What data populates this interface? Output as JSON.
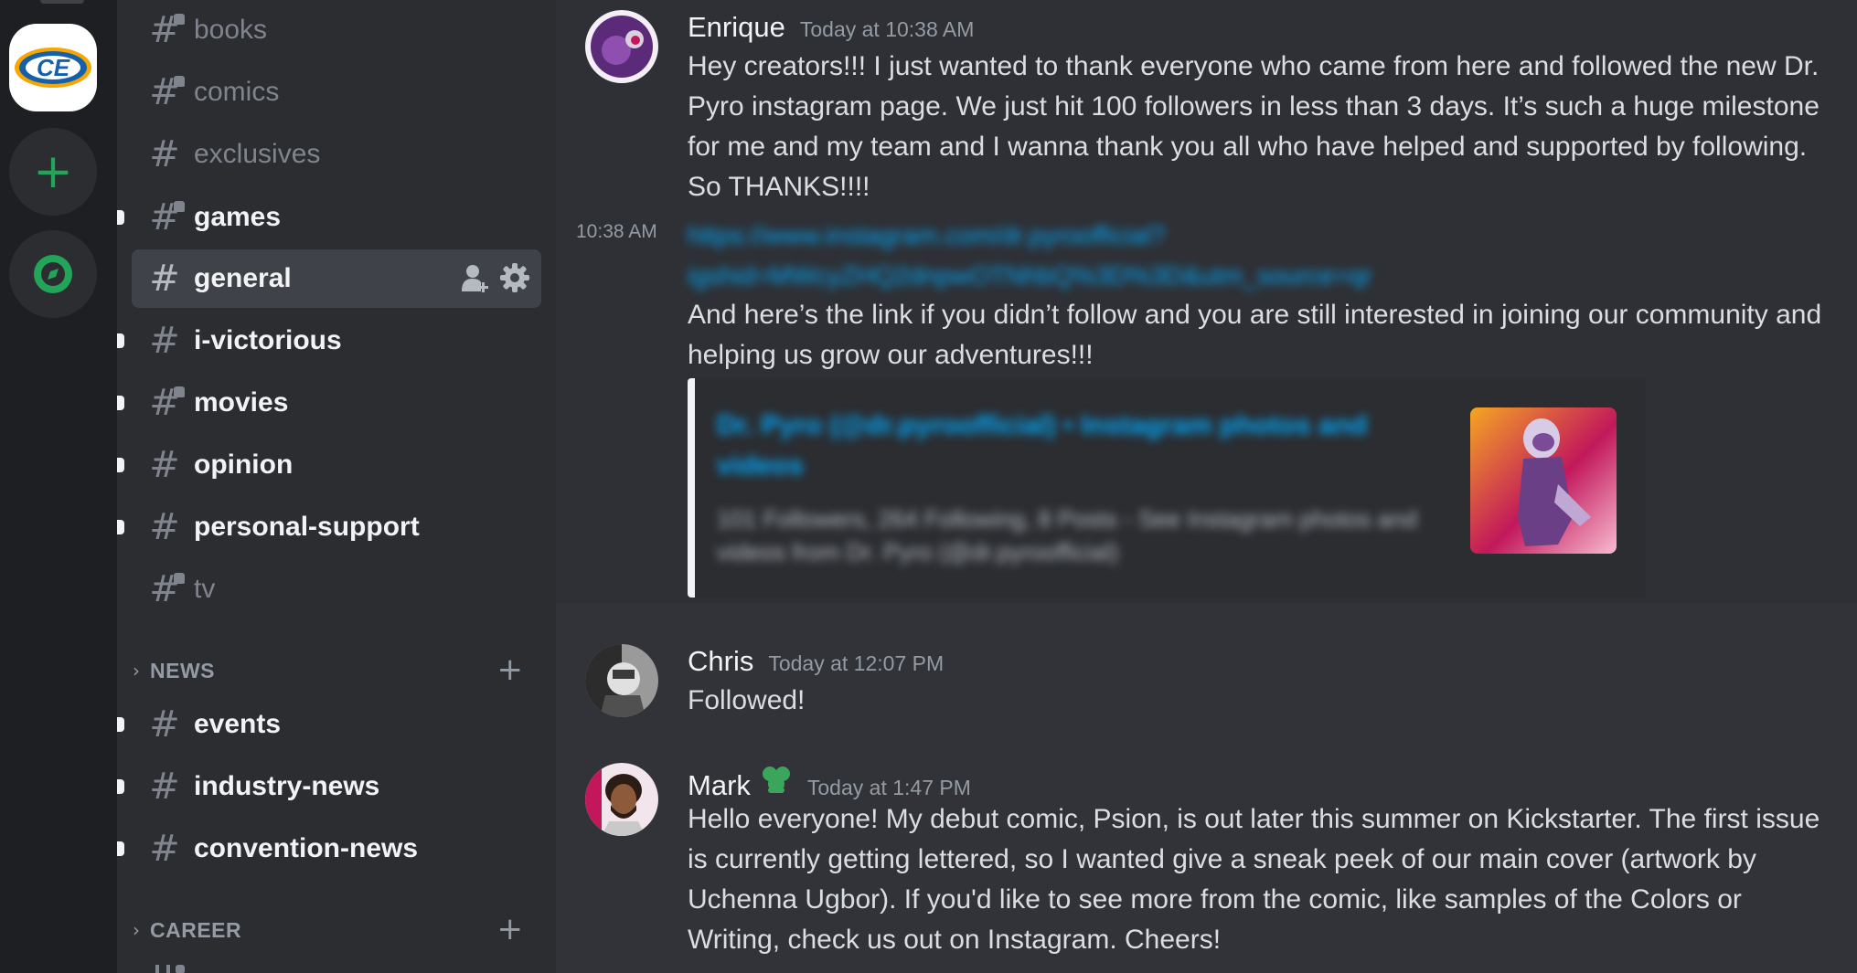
{
  "servers": [
    {
      "name": "ce-server",
      "logo_text": "CE"
    },
    {
      "name": "add-server"
    },
    {
      "name": "explore-servers"
    }
  ],
  "channels_top": [
    {
      "name": "books",
      "unread": false,
      "restricted": true
    },
    {
      "name": "comics",
      "unread": false,
      "restricted": true
    },
    {
      "name": "exclusives",
      "unread": false,
      "restricted": false
    },
    {
      "name": "games",
      "unread": true,
      "restricted": true
    },
    {
      "name": "general",
      "active": true
    },
    {
      "name": "i-victorious",
      "unread": true
    },
    {
      "name": "movies",
      "unread": true,
      "restricted": true
    },
    {
      "name": "opinion",
      "unread": true
    },
    {
      "name": "personal-support",
      "unread": true
    },
    {
      "name": "tv",
      "unread": false,
      "restricted": true
    }
  ],
  "categories": [
    {
      "label": "NEWS"
    },
    {
      "label": "CAREER"
    }
  ],
  "channels_news": [
    {
      "name": "events",
      "unread": true
    },
    {
      "name": "industry-news",
      "unread": true
    },
    {
      "name": "convention-news",
      "unread": true
    }
  ],
  "icons": {
    "add_server": "+",
    "hash": "#",
    "category_chevron": "›",
    "category_add": "+"
  },
  "colors": {
    "accent_green": "#23a559",
    "link_blue": "#00a8fc",
    "badge_green": "#3ba55c"
  },
  "messages": {
    "m1": {
      "author": "Enrique",
      "timestamp": "Today at 10:38 AM",
      "text": "Hey creators!!! I just wanted to thank everyone who came from here and followed the new Dr. Pyro instagram page. We just hit 100 followers in less than 3 days. It’s such a huge milestone for me and my team and I wanna thank you all who have helped and supported by following. So THANKS!!!!"
    },
    "m1b": {
      "side_time": "10:38 AM",
      "link_line1": "https://www.instagram.com/dr.pyroofficial?",
      "link_line2": "igshid=MWcyZHQ2dnpwOTNhbQ%3D%3D&utm_source=qr",
      "text": "And here’s the link if you didn’t follow and you are still interested in joining our community and helping us grow our adventures!!!",
      "embed_title": "Dr. Pyro (@dr.pyroofficial) • Instagram photos and videos",
      "embed_desc": "101 Followers, 264 Following, 8 Posts - See Instagram photos and videos from Dr. Pyro (@dr.pyroofficial)"
    },
    "m2": {
      "author": "Chris",
      "timestamp": "Today at 12:07 PM",
      "text": "Followed!"
    },
    "m3": {
      "author": "Mark",
      "timestamp": "Today at 1:47 PM",
      "text": "Hello everyone! My debut comic, Psion, is out later this summer on Kickstarter. The first issue is currently getting lettered, so I wanted give a sneak peek of our main cover (artwork by Uchenna Ugbor). If you'd like to see more from the comic, like samples of the Colors or Writing, check us out on Instagram. Cheers!"
    }
  }
}
